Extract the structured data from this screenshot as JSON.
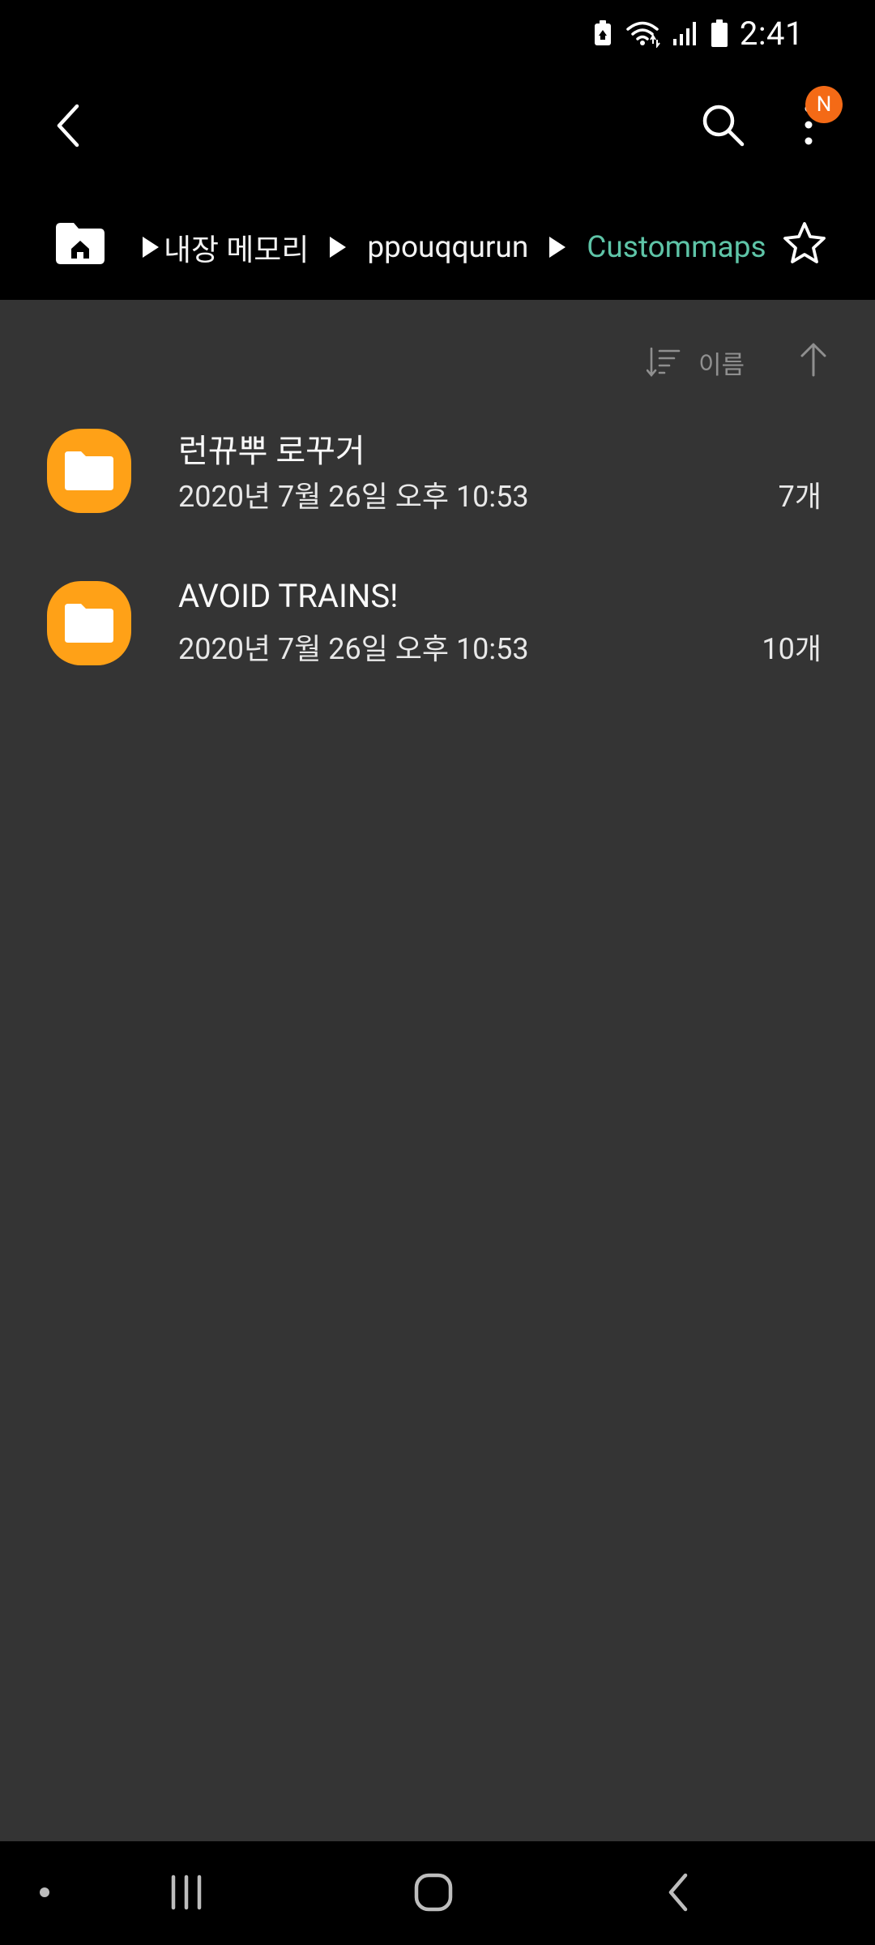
{
  "status_bar": {
    "time": "2:41",
    "icons": [
      "battery-saver-icon",
      "wifi-icon",
      "signal-icon",
      "battery-icon"
    ]
  },
  "app_bar": {
    "notification_badge": "N",
    "icons": [
      "back-icon",
      "search-icon",
      "more-options-icon"
    ]
  },
  "breadcrumb": {
    "items": [
      "내장 메모리",
      "ppouqqurun",
      "Custommaps"
    ],
    "current_color": "#5ec4a7"
  },
  "sort": {
    "label": "이름",
    "direction": "ascending"
  },
  "files": [
    {
      "name": "런뀨뿌 로꾸거",
      "date": "2020년 7월 26일 오후 10:53",
      "count": "7개",
      "type": "folder"
    },
    {
      "name": "AVOID TRAINS!",
      "date": "2020년 7월 26일 오후 10:53",
      "count": "10개",
      "type": "folder"
    }
  ],
  "colors": {
    "accent": "#5ec4a7",
    "folder": "#ffa117",
    "badge": "#f46a16",
    "content_bg": "#343434"
  },
  "nav_bar": {
    "icons": [
      "recents-icon",
      "home-icon",
      "back-nav-icon"
    ]
  }
}
